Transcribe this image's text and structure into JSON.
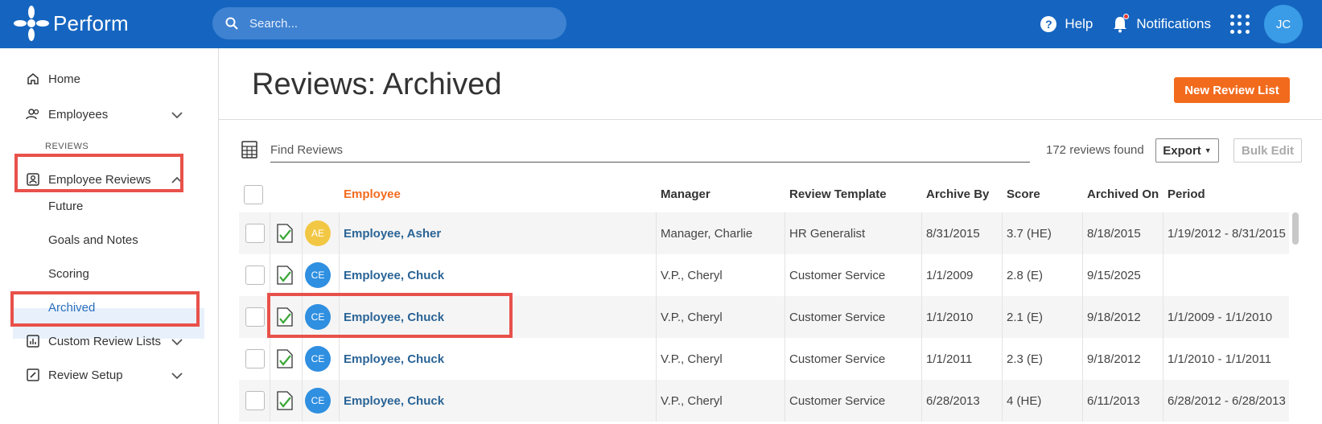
{
  "app": {
    "name": "Perform"
  },
  "search": {
    "placeholder": "Search..."
  },
  "topbar": {
    "help": "Help",
    "notifications": "Notifications",
    "user_initials": "JC"
  },
  "sidebar": {
    "home": "Home",
    "employees": "Employees",
    "section_label": "REVIEWS",
    "employee_reviews": "Employee Reviews",
    "sub": [
      "Future",
      "Goals and Notes",
      "Scoring",
      "Archived"
    ],
    "custom_review_lists": "Custom Review Lists",
    "review_setup": "Review Setup"
  },
  "page": {
    "title": "Reviews: Archived",
    "new_button": "New Review List",
    "find_placeholder": "Find Reviews",
    "found": "172 reviews found",
    "export": "Export",
    "bulk_edit": "Bulk Edit"
  },
  "table": {
    "headers": [
      "Employee",
      "Manager",
      "Review Template",
      "Archive By",
      "Score",
      "Archived On",
      "Period"
    ],
    "rows": [
      {
        "initials": "AE",
        "avatar_color": "#f2c744",
        "employee": "Employee, Asher",
        "manager": "Manager, Charlie",
        "template": "HR Generalist",
        "archive_by": "8/31/2015",
        "score": "3.7 (HE)",
        "archived_on": "8/18/2015",
        "period": "1/19/2012 - 8/31/2015"
      },
      {
        "initials": "CE",
        "avatar_color": "#2f8fe0",
        "employee": "Employee, Chuck",
        "manager": "V.P., Cheryl",
        "template": "Customer Service",
        "archive_by": "1/1/2009",
        "score": "2.8 (E)",
        "archived_on": "9/15/2025",
        "period": ""
      },
      {
        "initials": "CE",
        "avatar_color": "#2f8fe0",
        "employee": "Employee, Chuck",
        "manager": "V.P., Cheryl",
        "template": "Customer Service",
        "archive_by": "1/1/2010",
        "score": "2.1 (E)",
        "archived_on": "9/18/2012",
        "period": "1/1/2009 - 1/1/2010"
      },
      {
        "initials": "CE",
        "avatar_color": "#2f8fe0",
        "employee": "Employee, Chuck",
        "manager": "V.P., Cheryl",
        "template": "Customer Service",
        "archive_by": "1/1/2011",
        "score": "2.3 (E)",
        "archived_on": "9/18/2012",
        "period": "1/1/2010 - 1/1/2011"
      },
      {
        "initials": "CE",
        "avatar_color": "#2f8fe0",
        "employee": "Employee, Chuck",
        "manager": "V.P., Cheryl",
        "template": "Customer Service",
        "archive_by": "6/28/2013",
        "score": "4 (HE)",
        "archived_on": "6/11/2013",
        "period": "6/28/2012 - 6/28/2013"
      }
    ]
  },
  "colors": {
    "brand": "#1565c0",
    "accent": "#f26b1d",
    "highlight": "#e8514a"
  }
}
